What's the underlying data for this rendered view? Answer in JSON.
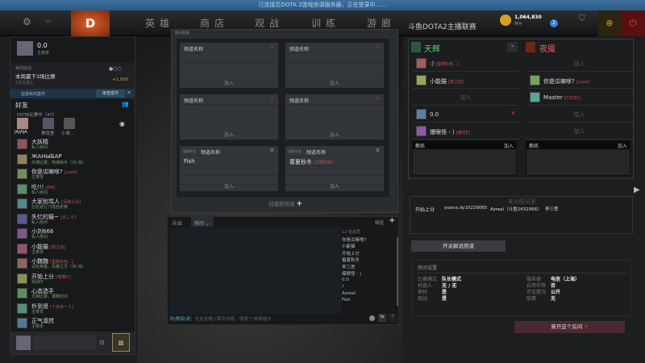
{
  "notice": "已连接至DOTA 2游戏协调服务器，正在登录中……",
  "nav": {
    "items": [
      "英雄",
      "商店",
      "观战",
      "训练",
      "游廊"
    ],
    "gold": "1,064,830",
    "gold_label": "碎片",
    "mail_count": "2"
  },
  "profile": {
    "name": "0.0",
    "status": "主菜单"
  },
  "weekly": {
    "title": "每周挑战",
    "task": "本周赢下3场比赛",
    "deadline": "3天后截止",
    "reward": "+1,000"
  },
  "overwatch": {
    "text": "监督新的案件",
    "button": "审查案件"
  },
  "friends": {
    "title": "好友",
    "section": "DOTA比赛中（47）",
    "party": [
      "JAJAJA",
      "黑夜里",
      "小哥..."
    ],
    "list": [
      {
        "name": "大妖精",
        "tag": "",
        "status": "私人房间"
      },
      {
        "name": "ЖАНЫБАР",
        "tag": "",
        "status": "天梯比赛，电魂雨手（25 级）"
      },
      {
        "name": "你是瓜嘛嗲?",
        "tag": "[yyed]",
        "status": "主菜单"
      },
      {
        "name": "吃!!!",
        "tag": "[KIA]",
        "status": "私人房间"
      },
      {
        "name": "大家别骂人",
        "tag": "[深渊士兵]",
        "status": "在此进行刀塔自走棋"
      },
      {
        "name": "失忆的猫~",
        "tag": "[ましろ]",
        "status": "私人房间"
      },
      {
        "name": "小刘666",
        "tag": "",
        "status": "私人房间"
      },
      {
        "name": "小能猫",
        "tag": "[熊之前]",
        "status": "主菜单"
      },
      {
        "name": "小魏魏",
        "tag": "[墨丽松色...]",
        "status": "试玩英雄，风暴之灵（30 级）"
      },
      {
        "name": "开始上分",
        "tag": "[喵喵叮]",
        "status": "观战中"
      },
      {
        "name": "心态选手",
        "tag": "",
        "status": "天梯比赛，僵略时间"
      },
      {
        "name": "朴到贤",
        "tag": "[十步杀一人]",
        "status": "主菜单"
      },
      {
        "name": "正气凛然",
        "tag": "",
        "status": "主菜单"
      }
    ]
  },
  "channels": {
    "header": "聊天频道",
    "cards": [
      {
        "title": "频道名称",
        "member": "",
        "join": "加入"
      },
      {
        "title": "频道名称",
        "member": "",
        "join": "加入"
      },
      {
        "title": "频道名称",
        "member": "",
        "join": "加入"
      },
      {
        "title": "频道名称",
        "member": "",
        "join": "加入"
      },
      {
        "pre": "简体中文",
        "title": "频道名称",
        "member": "Fish",
        "join": "加入"
      },
      {
        "pre": "简体中文",
        "title": "频道名称",
        "member": "春夏秋冬",
        "member_tag": "[文明玩家]",
        "join": "加入"
      }
    ],
    "create": "创建新频道"
  },
  "chat": {
    "tabs": [
      "队伍",
      "房间"
    ],
    "channel_label": "频道",
    "member_count": "12 名成员",
    "members": [
      "你是瓜嘛嗲?",
      "小能猫",
      "开始上分",
      "春夏秋冬",
      "李三思",
      "爆眼怪 - )",
      "0.0",
      ")",
      "Azreal",
      "Fish"
    ],
    "input_prefix": "对(房间)说：",
    "input_placeholder": "在此处输入聊天内容。使用\"/\"启用指令。"
  },
  "lobby": {
    "title": "斗鱼DOTA2主播联赛",
    "radiant": {
      "name": "天辉",
      "slots": [
        {
          "name": ":)",
          "tag": "[墨丽松色...]"
        },
        {
          "name": "小能猫",
          "tag": "[熊之前]"
        },
        {
          "join": "加入"
        },
        {
          "name": "0.0",
          "tag": ""
        },
        {
          "name": "爆眼怪 - )",
          "tag": "[喵叮E]"
        }
      ]
    },
    "dire": {
      "name": "夜魇",
      "slots": [
        {
          "join": "加入"
        },
        {
          "name": "你是瓜嘛嗲?",
          "tag": "[yyed]"
        },
        {
          "name": "Master",
          "tag": "[CSCEC]"
        },
        {
          "join": "加入"
        },
        {
          "join": "加入"
        }
      ]
    },
    "coach": "教练",
    "join": "加入",
    "unassigned": {
      "title": "未分配玩家",
      "players": [
        "开始上分",
        "yoona.dy10229065",
        "Azreal（斗鱼2431066）",
        "李三思"
      ]
    },
    "caster_button": "开关解说频道",
    "settings": {
      "title": "房间设置",
      "left": [
        [
          "比赛模式",
          "队长模式"
        ],
        [
          "机器人",
          "无 / 无"
        ],
        [
          "密码",
          "是"
        ],
        [
          "观战",
          "是"
        ]
      ],
      "right": [
        [
          "服务器",
          "电信（上海）"
        ],
        [
          "启用作弊",
          "否"
        ],
        [
          "可见情况",
          "公开"
        ],
        [
          "联赛",
          "无"
        ]
      ]
    },
    "leave": "离开这个房间"
  },
  "colors": {
    "radiant": "#5fd37a",
    "dire": "#e06060",
    "accent": "#e0602a"
  }
}
